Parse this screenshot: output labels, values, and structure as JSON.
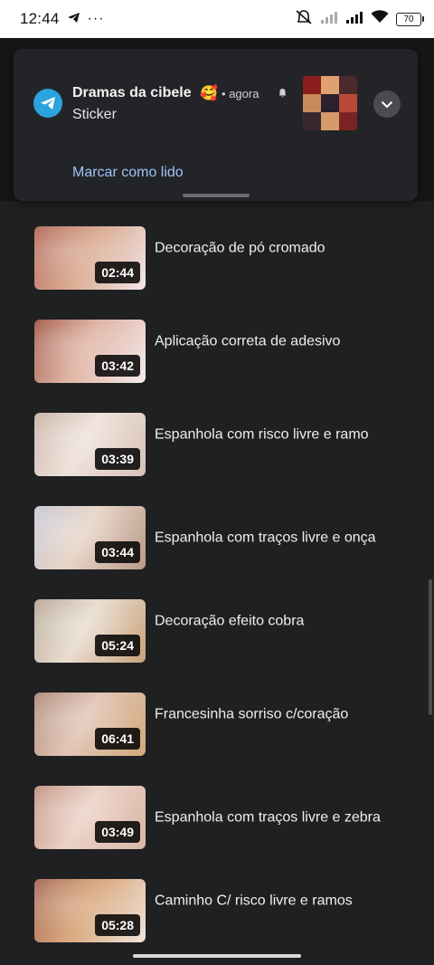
{
  "status_bar": {
    "time": "12:44",
    "battery": "70"
  },
  "notification": {
    "app_icon": "telegram-icon",
    "title": "Dramas da cibele",
    "emoji": "🥰",
    "separator": "•",
    "time": "agora",
    "subtitle": "Sticker",
    "action": "Marcar como lido"
  },
  "videos": [
    {
      "duration": "02:44",
      "title": "Decoração de pó cromado",
      "colors": [
        "#b46a5c",
        "#d9a98f",
        "#f2e6e8"
      ]
    },
    {
      "duration": "03:42",
      "title": "Aplicação correta de adesivo",
      "colors": [
        "#a35a4a",
        "#e0b4a4",
        "#f4eaec"
      ]
    },
    {
      "duration": "03:39",
      "title": "Espanhola com risco livre e ramo",
      "colors": [
        "#c9b3a6",
        "#efe2da",
        "#d6c2b8"
      ]
    },
    {
      "duration": "03:44",
      "title": "Espanhola com traços livre e onça",
      "colors": [
        "#c8c8d6",
        "#e8d4c6",
        "#b89a88"
      ]
    },
    {
      "duration": "05:24",
      "title": "Decoração efeito cobra",
      "colors": [
        "#b8a898",
        "#e9ddd0",
        "#c9a27a"
      ]
    },
    {
      "duration": "06:41",
      "title": "Francesinha sorriso c/coração",
      "colors": [
        "#b08a7c",
        "#e2c6b6",
        "#d2a97a"
      ]
    },
    {
      "duration": "03:49",
      "title": "Espanhola com traços livre e zebra",
      "colors": [
        "#c49384",
        "#ecd2c6",
        "#d8b8a8"
      ]
    },
    {
      "duration": "05:28",
      "title": "Caminho C/ risco livre e ramos",
      "colors": [
        "#a86a56",
        "#d9a77c",
        "#f0e4dc"
      ]
    }
  ]
}
